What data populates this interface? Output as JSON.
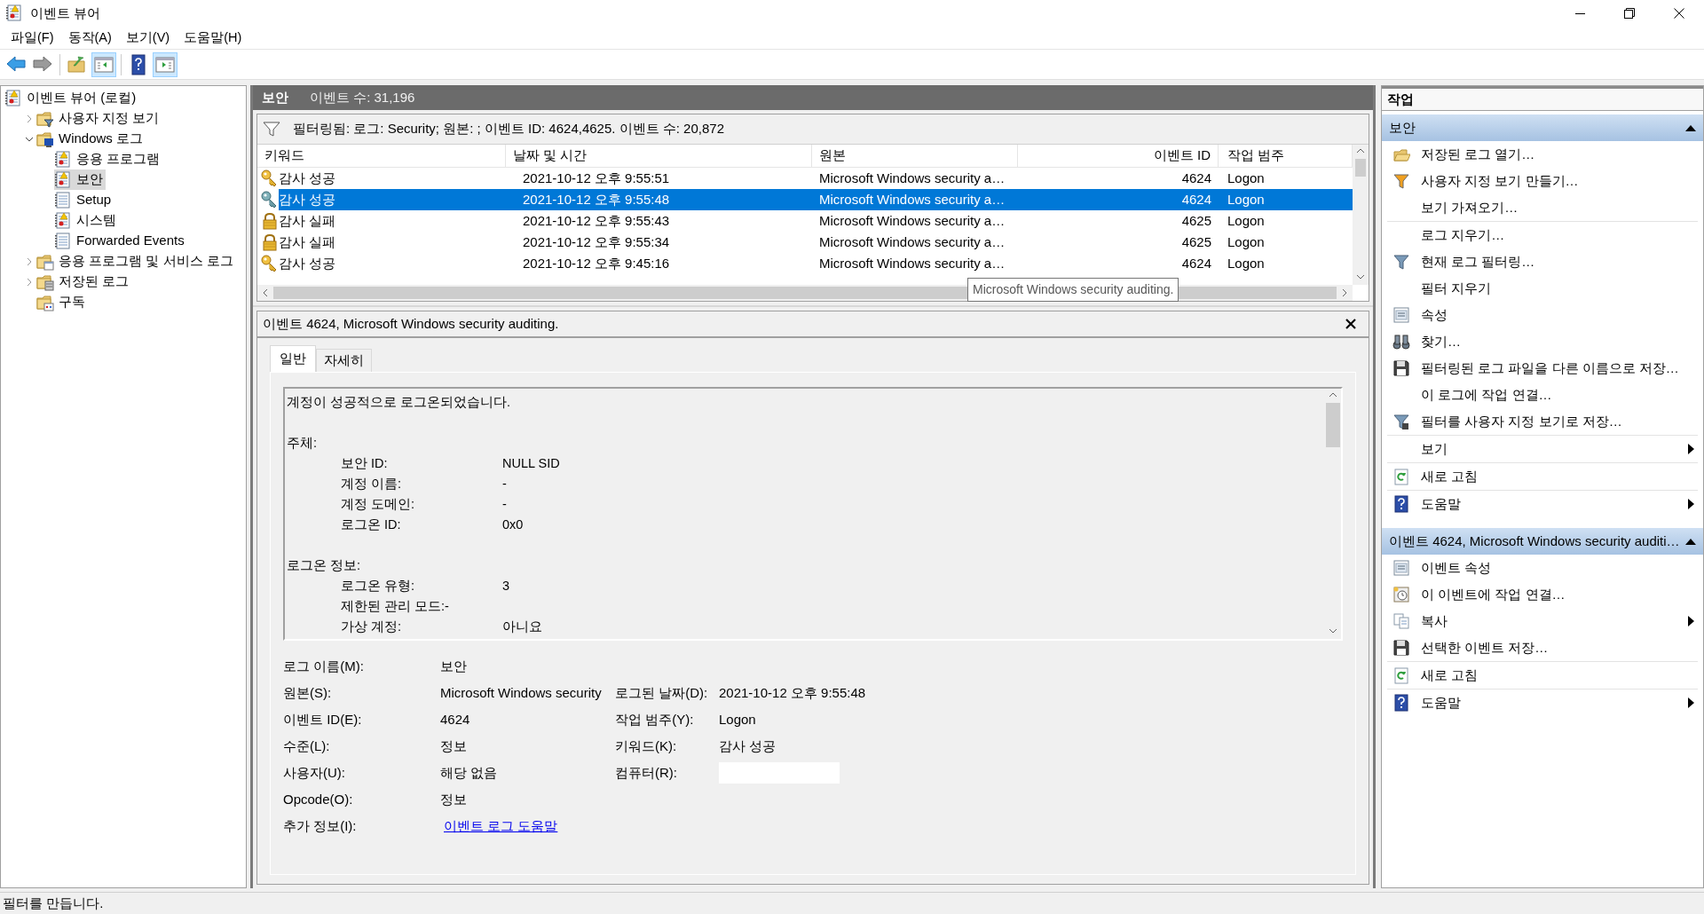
{
  "window": {
    "title": "이벤트 뷰어"
  },
  "menu": [
    "파일(F)",
    "동작(A)",
    "보기(V)",
    "도움말(H)"
  ],
  "toolbar": [
    {
      "kind": "back",
      "pressed": false
    },
    {
      "kind": "forward",
      "pressed": false
    },
    {
      "kind": "separator"
    },
    {
      "kind": "up",
      "pressed": false
    },
    {
      "kind": "tree",
      "pressed": true
    },
    {
      "kind": "separator"
    },
    {
      "kind": "help",
      "pressed": false
    },
    {
      "kind": "actions",
      "pressed": true
    }
  ],
  "tree": [
    {
      "label": "이벤트 뷰어 (로컬)",
      "kind": "viewer",
      "selected": false,
      "children": [
        {
          "label": "사용자 지정 보기",
          "kind": "folder-filter",
          "expanded": false,
          "selected": false
        },
        {
          "label": "Windows 로그",
          "kind": "folder-pc",
          "expanded": true,
          "selected": false,
          "children": [
            {
              "label": "응용 프로그램",
              "kind": "log-alert",
              "selected": false
            },
            {
              "label": "보안",
              "kind": "log-alert",
              "selected": true
            },
            {
              "label": "Setup",
              "kind": "log",
              "selected": false
            },
            {
              "label": "시스템",
              "kind": "log-alert",
              "selected": false
            },
            {
              "label": "Forwarded Events",
              "kind": "log",
              "selected": false
            }
          ]
        },
        {
          "label": "응용 프로그램 및 서비스 로그",
          "kind": "folder-app",
          "expanded": false,
          "selected": false
        },
        {
          "label": "저장된 로그",
          "kind": "folder-saved",
          "expanded": false,
          "selected": false
        },
        {
          "label": "구독",
          "kind": "folder-sub",
          "selected": false
        }
      ]
    }
  ],
  "log_header": {
    "title": "보안",
    "count": "이벤트 수: 31,196"
  },
  "filter": "필터링됨: 로그: Security; 원본: ; 이벤트 ID: 4624,4625. 이벤트 수: 20,872",
  "columns": [
    "키워드",
    "날짜 및 시간",
    "원본",
    "이벤트 ID",
    "작업 범주"
  ],
  "rows": [
    {
      "kind": "success",
      "keyword": "감사 성공",
      "date": "2021-10-12 오후 9:55:51",
      "source": "Microsoft Windows security a…",
      "id": "4624",
      "category": "Logon",
      "selected": false
    },
    {
      "kind": "success",
      "keyword": "감사 성공",
      "date": "2021-10-12 오후 9:55:48",
      "source": "Microsoft Windows security a…",
      "id": "4624",
      "category": "Logon",
      "selected": true
    },
    {
      "kind": "failure",
      "keyword": "감사 실패",
      "date": "2021-10-12 오후 9:55:43",
      "source": "Microsoft Windows security a…",
      "id": "4625",
      "category": "Logon",
      "selected": false
    },
    {
      "kind": "failure",
      "keyword": "감사 실패",
      "date": "2021-10-12 오후 9:55:34",
      "source": "Microsoft Windows security a…",
      "id": "4625",
      "category": "Logon",
      "selected": false
    },
    {
      "kind": "success",
      "keyword": "감사 성공",
      "date": "2021-10-12 오후 9:45:16",
      "source": "Microsoft Windows security a…",
      "id": "4624",
      "category": "Logon",
      "selected": false
    }
  ],
  "tooltip": "Microsoft Windows security auditing.",
  "detail": {
    "title": "이벤트 4624, Microsoft Windows security auditing.",
    "tabs": [
      {
        "label": "일반",
        "selected": true
      },
      {
        "label": "자세히",
        "selected": false
      }
    ],
    "message": {
      "first": "계정이 성공적으로 로그온되었습니다.",
      "sections": [
        {
          "title": "주체:",
          "fields": [
            {
              "label": "보안 ID:",
              "value": "NULL SID"
            },
            {
              "label": "계정 이름:",
              "value": "-"
            },
            {
              "label": "계정 도메인:",
              "value": "-"
            },
            {
              "label": "로그온 ID:",
              "value": "0x0"
            }
          ]
        },
        {
          "title": "로그온 정보:",
          "fields": [
            {
              "label": "로그온 유형:",
              "value": "3"
            },
            {
              "label": "제한된 관리 모드:-"
            },
            {
              "label": "가상 계정:",
              "value": "아니요"
            }
          ]
        }
      ]
    },
    "fields": [
      [
        {
          "label": "로그 이름(M):",
          "value": "보안"
        }
      ],
      [
        {
          "label": "원본(S):",
          "value": "Microsoft Windows security"
        },
        {
          "label": "로그된 날짜(D):",
          "value": "2021-10-12 오후 9:55:48"
        }
      ],
      [
        {
          "label": "이벤트 ID(E):",
          "value": "4624"
        },
        {
          "label": "작업 범주(Y):",
          "value": "Logon"
        }
      ],
      [
        {
          "label": "수준(L):",
          "value": "정보"
        },
        {
          "label": "키워드(K):",
          "value": "감사 성공"
        }
      ],
      [
        {
          "label": "사용자(U):",
          "value": "해당 없음"
        },
        {
          "label": "컴퓨터(R):",
          "kind": "redacted"
        }
      ],
      [
        {
          "label": "Opcode(O):",
          "value": "정보"
        }
      ],
      [
        {
          "label": "추가 정보(I):",
          "value": "이벤트 로그 도움말",
          "kind": "link"
        }
      ]
    ]
  },
  "actions": {
    "title": "작업",
    "sections": [
      {
        "title": "보안",
        "expanded": true,
        "groups": [
          [
            {
              "label": "저장된 로그 열기…",
              "kind": "folder"
            },
            {
              "label": "사용자 지정 보기 만들기…",
              "kind": "funnel-color"
            },
            {
              "label": "보기 가져오기…"
            }
          ],
          [
            {
              "label": "로그 지우기…"
            },
            {
              "label": "현재 로그 필터링…",
              "kind": "funnel"
            },
            {
              "label": "필터 지우기"
            },
            {
              "label": "속성",
              "kind": "props"
            },
            {
              "label": "찾기…",
              "kind": "binoculars"
            },
            {
              "label": "필터링된 로그 파일을 다른 이름으로 저장…",
              "kind": "save"
            },
            {
              "label": "이 로그에 작업 연결…"
            },
            {
              "label": "필터를 사용자 지정 보기로 저장…",
              "kind": "funnel-save"
            }
          ],
          [
            {
              "label": "보기",
              "submenu": true
            }
          ],
          [
            {
              "label": "새로 고침",
              "kind": "refresh"
            }
          ],
          [
            {
              "label": "도움말",
              "kind": "help",
              "submenu": true
            }
          ]
        ]
      },
      {
        "title": "이벤트 4624, Microsoft Windows security auditi…",
        "expanded": true,
        "groups": [
          [
            {
              "label": "이벤트 속성",
              "kind": "props"
            },
            {
              "label": "이 이벤트에 작업 연결…",
              "kind": "task"
            },
            {
              "label": "복사",
              "kind": "copy",
              "submenu": true
            },
            {
              "label": "선택한 이벤트 저장…",
              "kind": "save"
            }
          ],
          [
            {
              "label": "새로 고침",
              "kind": "refresh"
            }
          ],
          [
            {
              "label": "도움말",
              "kind": "help",
              "submenu": true
            }
          ]
        ]
      }
    ]
  },
  "status_bar": "필터를 만듭니다."
}
